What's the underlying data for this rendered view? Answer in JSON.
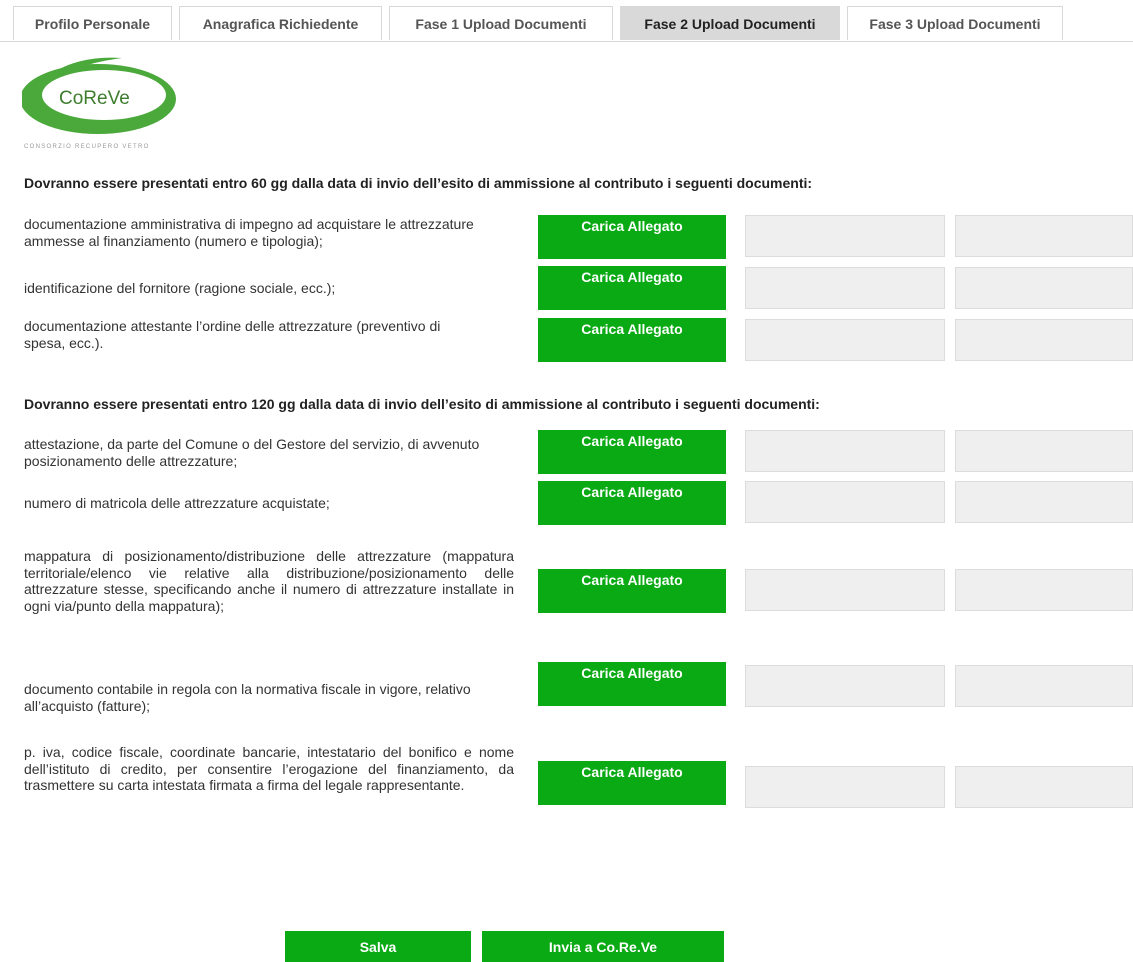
{
  "tabs": [
    {
      "label": "Profilo Personale"
    },
    {
      "label": "Anagrafica Richiedente"
    },
    {
      "label": "Fase 1 Upload Documenti"
    },
    {
      "label": "Fase 2 Upload Documenti",
      "active": true
    },
    {
      "label": "Fase 3 Upload Documenti"
    }
  ],
  "logo": {
    "name": "CoReVe",
    "subtitle": "CONSORZIO RECUPERO VETRO"
  },
  "section1": {
    "heading": "Dovranno essere presentati entro 60 gg dalla data di invio dell’esito di ammissione al contributo i seguenti documenti:",
    "docs": [
      {
        "label": "documentazione amministrativa di impegno ad acquistare le attrezzature ammesse al finanziamento (numero e tipologia);"
      },
      {
        "label": "identificazione del fornitore (ragione sociale, ecc.);"
      },
      {
        "label": "documentazione attestante l’ordine delle attrezzature (preventivo di spesa, ecc.)."
      }
    ]
  },
  "section2": {
    "heading": "Dovranno essere presentati entro 120 gg dalla data di invio dell’esito di ammissione al contributo i seguenti documenti:",
    "docs": [
      {
        "label": "attestazione, da parte del Comune o del Gestore del servizio, di avvenuto posizionamento delle attrezzature;"
      },
      {
        "label": "numero di matricola delle attrezzature acquistate;"
      },
      {
        "label": "mappatura di posizionamento/distribuzione delle attrezzature (mappatura territoriale/elenco vie relative alla distribuzione/posizionamento delle attrezzature stesse, specificando anche il numero di attrezzature installate in ogni via/punto della mappatura);"
      },
      {
        "label": "documento contabile in regola con la normativa fiscale in vigore, relativo all’acquisto (fatture);"
      },
      {
        "label": "p. iva, codice fiscale, coordinate bancarie, intestatario del bonifico e nome dell’istituto di credito, per consentire l’erogazione del finanziamento, da trasmettere su carta intestata firmata a firma del legale rappresentante."
      }
    ]
  },
  "upload_label": "Carica Allegato",
  "actions": {
    "save": "Salva",
    "send": "Invia a Co.Re.Ve"
  },
  "colors": {
    "button_green": "#0aaa14",
    "active_tab": "#d9d9d9",
    "file_box": "#efefef",
    "logo_green": "#4aa93a"
  }
}
